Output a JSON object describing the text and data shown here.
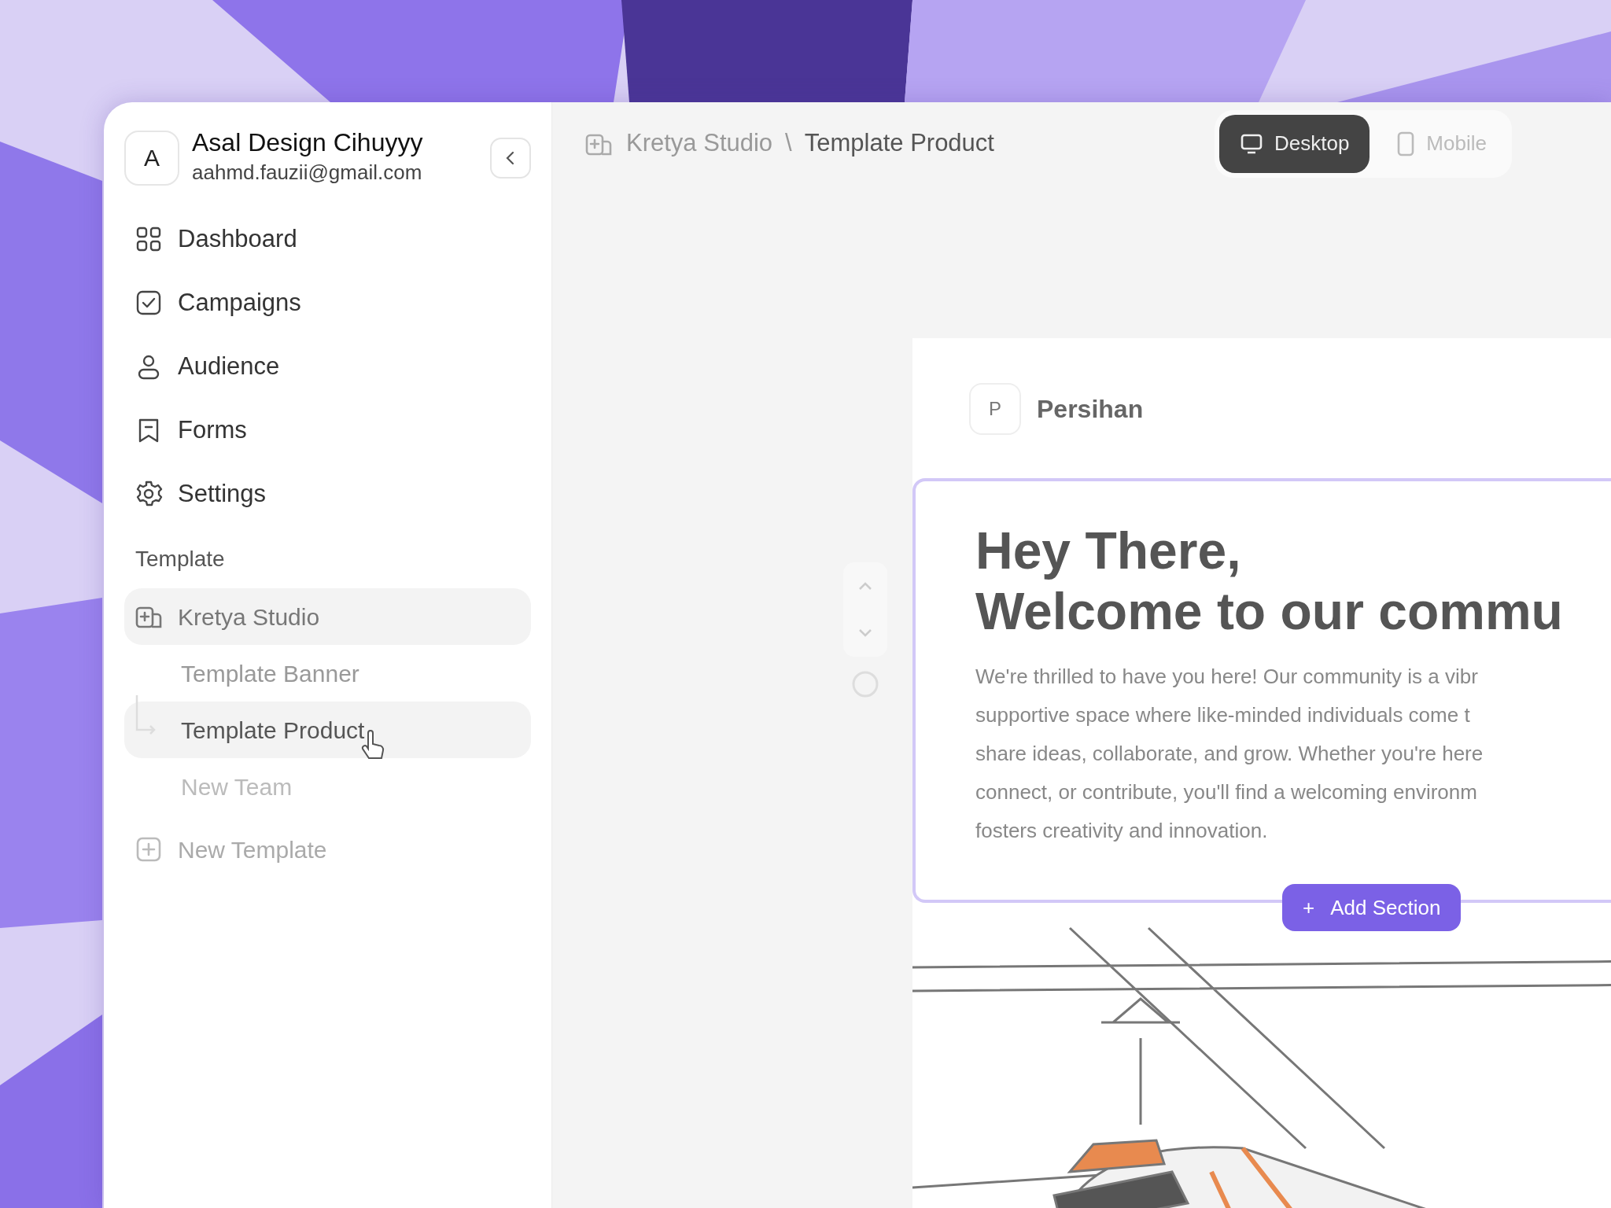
{
  "account": {
    "avatar_letter": "A",
    "name": "Asal Design Cihuyyy",
    "email": "aahmd.fauzii@gmail.com"
  },
  "nav": [
    {
      "label": "Dashboard",
      "kind": "grid"
    },
    {
      "label": "Campaigns",
      "kind": "check"
    },
    {
      "label": "Audience",
      "kind": "person"
    },
    {
      "label": "Forms",
      "kind": "bookmark"
    },
    {
      "label": "Settings",
      "kind": "gear"
    }
  ],
  "templates": {
    "heading": "Template",
    "groups": [
      {
        "label": "Kretya Studio",
        "selected": true,
        "children": [
          {
            "label": "Template Banner",
            "selected": false
          },
          {
            "label": "Template Product",
            "selected": true
          },
          {
            "label": "New Team",
            "selected": false
          }
        ]
      }
    ],
    "new_template": "New Template"
  },
  "breadcrumb": {
    "items": [
      "Kretya Studio",
      "Template Product"
    ],
    "separator": "\\"
  },
  "view_modes": [
    {
      "label": "Desktop",
      "kind": "desktop",
      "selected": true
    },
    {
      "label": "Mobile",
      "kind": "mobile",
      "selected": false
    }
  ],
  "canvas": {
    "brand": {
      "letter": "P",
      "name": "Persihan"
    },
    "title_lines": [
      "Hey There,",
      "Welcome to our commu"
    ],
    "body": "We're thrilled to have you here! Our community is a vibr\nsupportive space where like-minded individuals come t\nshare ideas, collaborate, and grow. Whether you're here\nconnect, or contribute, you'll find a welcoming environm\nfosters creativity and innovation.",
    "add_section": {
      "icon": "+",
      "label": "Add Section"
    }
  }
}
